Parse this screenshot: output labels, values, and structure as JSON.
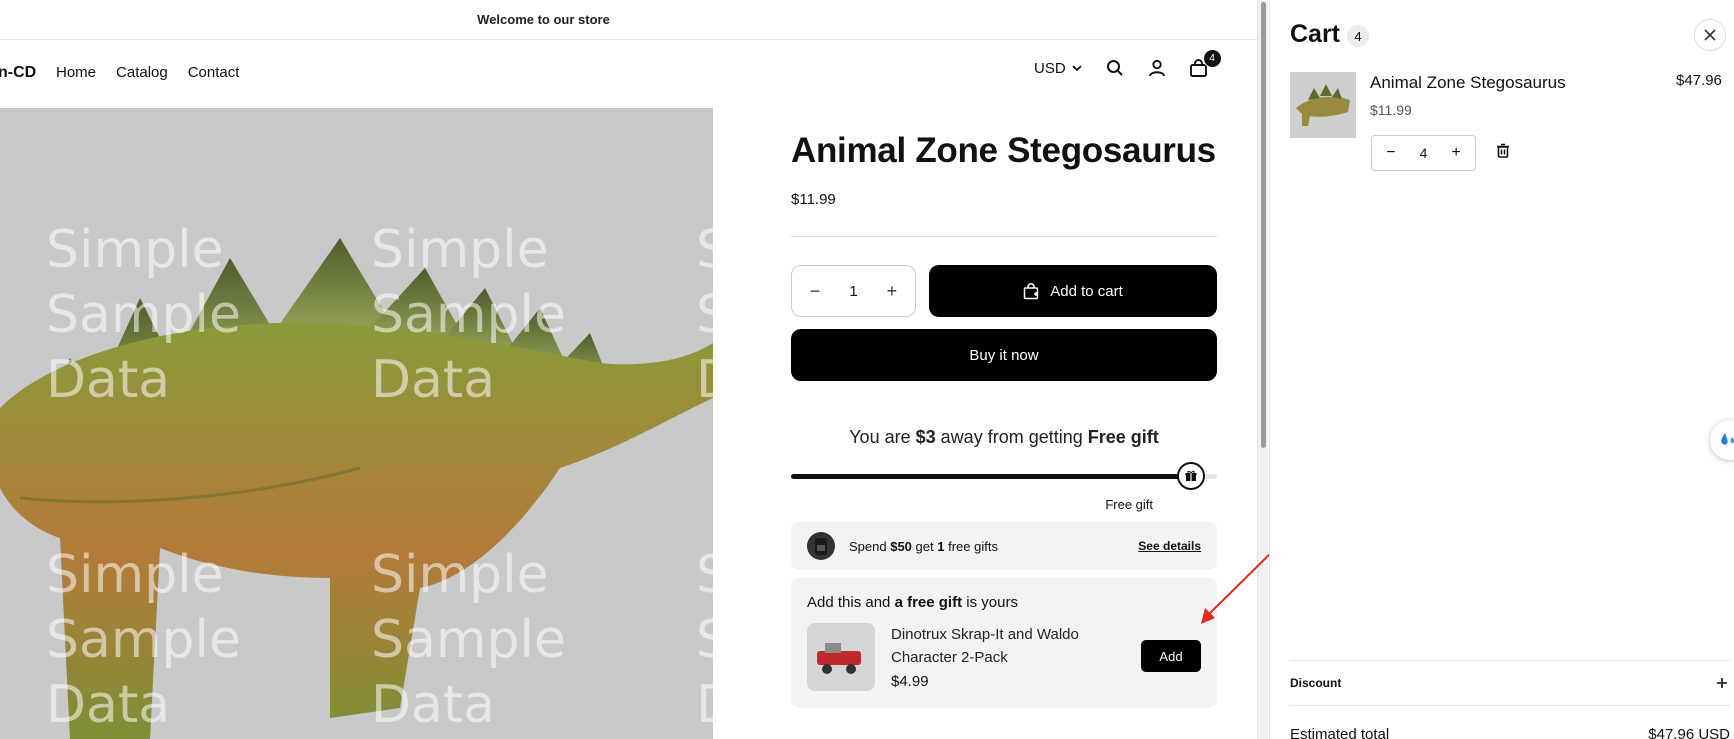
{
  "announcement": "Welcome to our store",
  "header": {
    "logo": "n-CD",
    "nav": [
      "Home",
      "Catalog",
      "Contact"
    ],
    "currency": "USD",
    "cart_count": "4"
  },
  "hero": {
    "watermark_lines": [
      "Simple",
      "Sample",
      "Data"
    ]
  },
  "product": {
    "title": "Animal Zone Stegosaurus",
    "price": "$11.99",
    "quantity": "1",
    "add_to_cart": "Add to cart",
    "buy_now": "Buy it now"
  },
  "promo": {
    "prefix": "You are",
    "amount": "$3",
    "middle": "away from getting",
    "goal": "Free gift",
    "progress": 0.94,
    "milestone_label": "Free gift"
  },
  "spend_offer": {
    "text_1": "Spend",
    "amount": "$50",
    "text_2": "get",
    "count": "1",
    "text_3": "free gifts",
    "link": "See details"
  },
  "gift_offer": {
    "head_1": "Add this and",
    "head_bold": "a free gift",
    "head_2": "is yours",
    "item_name": "Dinotrux Skrap-It and Waldo Character 2-Pack",
    "item_price": "$4.99",
    "add_label": "Add"
  },
  "cart": {
    "title": "Cart",
    "count": "4",
    "item": {
      "name": "Animal Zone Stegosaurus",
      "unit_price": "$11.99",
      "line_total": "$47.96",
      "quantity": "4"
    },
    "discount_label": "Discount",
    "estimated_label": "Estimated total",
    "estimated_value": "$47.96 USD"
  },
  "colors": {
    "annotation_arrow": "#e8261c",
    "primary": "#000000"
  }
}
